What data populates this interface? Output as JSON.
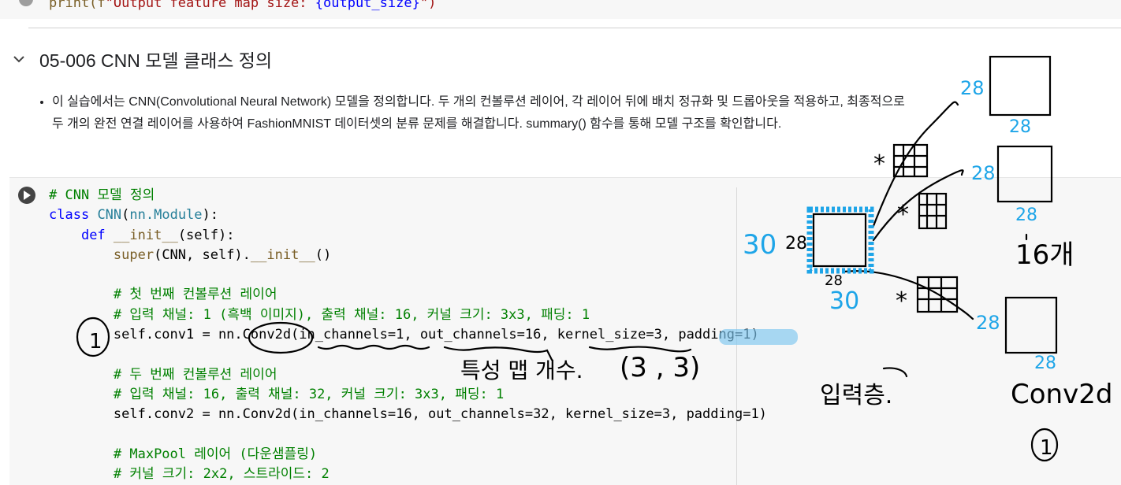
{
  "previous_cell": {
    "code_prefix": "print(f",
    "code_string_a": "\"Output feature map size: ",
    "code_var": "{output_size}",
    "code_string_b": "\")"
  },
  "section": {
    "title": "05-006 CNN 모델 클래스 정의"
  },
  "description": {
    "text": "이 실습에서는 CNN(Convolutional Neural Network) 모델을 정의합니다. 두 개의 컨볼루션 레이어, 각 레이어 뒤에 배치 정규화 및 드롭아웃을 적용하고, 최종적으로 두 개의 완전 연결 레이어를 사용하여 FashionMNIST 데이터셋의 분류 문제를 해결합니다. summary() 함수를 통해 모델 구조를 확인합니다."
  },
  "code": {
    "l1": "# CNN 모델 정의",
    "l2_kw": "class",
    "l2_name": "CNN",
    "l2_rest_a": "(",
    "l2_base": "nn.Module",
    "l2_rest_b": "):",
    "l3_kw": "def",
    "l3_fn": "__init__",
    "l3_args": "(self):",
    "l4_fn": "super",
    "l4_a": "(CNN, self).",
    "l4_b": "__init__",
    "l4_c": "()",
    "l6": "# 첫 번째 컨볼루션 레이어",
    "l7": "# 입력 채널: 1 (흑백 이미지), 출력 채널: 16, 커널 크기: 3x3, 패딩: 1",
    "l8": "self.conv1 = nn.Conv2d(in_channels=1, out_channels=16, kernel_size=3, padding=1)",
    "l10": "# 두 번째 컨볼루션 레이어",
    "l11": "# 입력 채널: 16, 출력 채널: 32, 커널 크기: 3x3, 패딩: 1",
    "l12": "self.conv2 = nn.Conv2d(in_channels=16, out_channels=32, kernel_size=3, padding=1)",
    "l14": "# MaxPool 레이어 (다운샘플링)",
    "l15": "# 커널 크기: 2x2, 스트라이드: 2"
  },
  "annotations": {
    "circle_one_left": "1",
    "feature_map_count": "특성 맵 개수.",
    "kernel_tuple": "(3 , 3)",
    "input_layer": "입력층.",
    "n30_left": "30",
    "n28_left": "28",
    "n28_bottom": "28",
    "n30_bottom": "30",
    "n28_map1_side": "28",
    "n28_map1_bottom": "28",
    "n28_map2_side": "28",
    "n28_map2_bottom": "28",
    "n28_map3_side": "28",
    "n28_map3_bottom": "28",
    "count_16": "16개",
    "conv2d": "Conv2d",
    "circle_one_right": "1",
    "star": "*"
  },
  "colors": {
    "blue_ink": "#1ea5e8",
    "black_ink": "#000000",
    "highlight": "#7cc6ef"
  },
  "icons": {
    "chevron": "chevron-down-icon",
    "run": "run-cell-icon"
  }
}
